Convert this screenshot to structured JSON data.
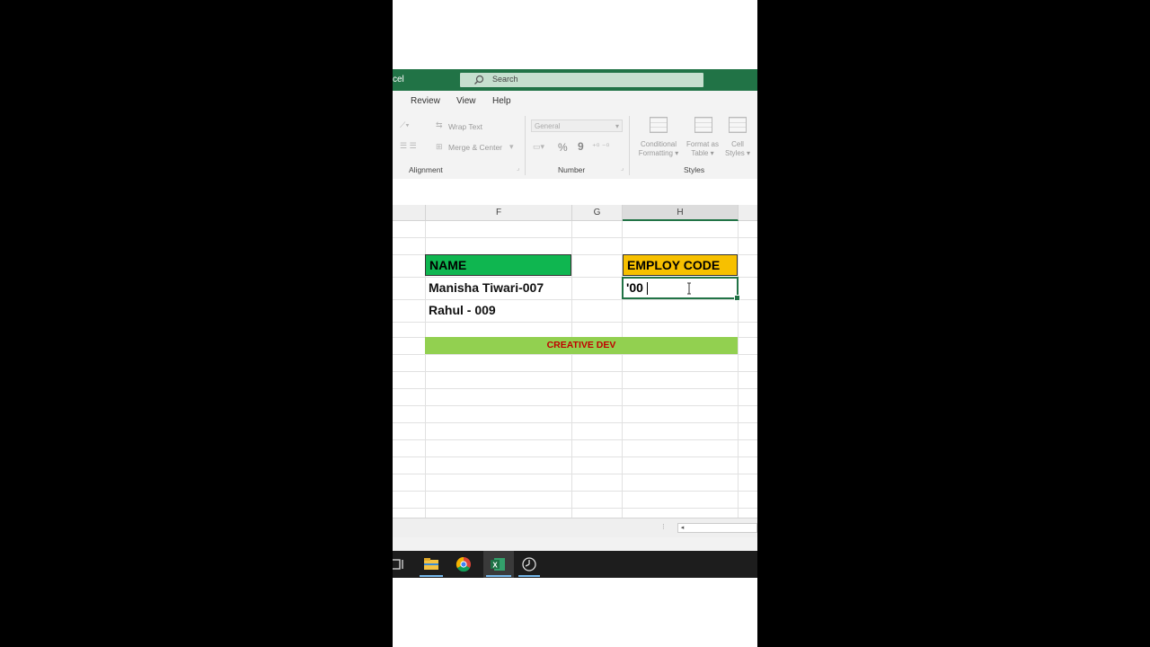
{
  "titlebar": {
    "app_fragment": "cel",
    "search_placeholder": "Search"
  },
  "ribbon": {
    "tabs": [
      "Review",
      "View",
      "Help"
    ],
    "alignment": {
      "wrap_text": "Wrap Text",
      "merge_center": "Merge & Center",
      "group_label": "Alignment"
    },
    "number": {
      "format_value": "General",
      "percent": "%",
      "comma": "9",
      "group_label": "Number"
    },
    "styles": {
      "conditional": [
        "Conditional",
        "Formatting ▾"
      ],
      "format_table": [
        "Format as",
        "Table ▾"
      ],
      "cell_styles": [
        "Cell",
        "Styles ▾"
      ],
      "group_label": "Styles"
    }
  },
  "grid": {
    "columns": [
      "F",
      "G",
      "H"
    ],
    "selected_column": "H",
    "name_header": "NAME",
    "employ_header": "EMPLOY CODE",
    "names": [
      "Manisha Tiwari-007",
      "Rahul - 009"
    ],
    "active_cell_value": "'00",
    "banner": "CREATIVE DEV"
  },
  "colors": {
    "excel_green": "#217346",
    "name_header_bg": "#0fb650",
    "employ_header_bg": "#f7c000",
    "banner_bg": "#92d050",
    "banner_text": "#c00000"
  },
  "taskbar": {
    "icons": [
      "task-view-icon",
      "file-explorer-icon",
      "chrome-icon",
      "excel-icon",
      "clock-app-icon"
    ]
  }
}
